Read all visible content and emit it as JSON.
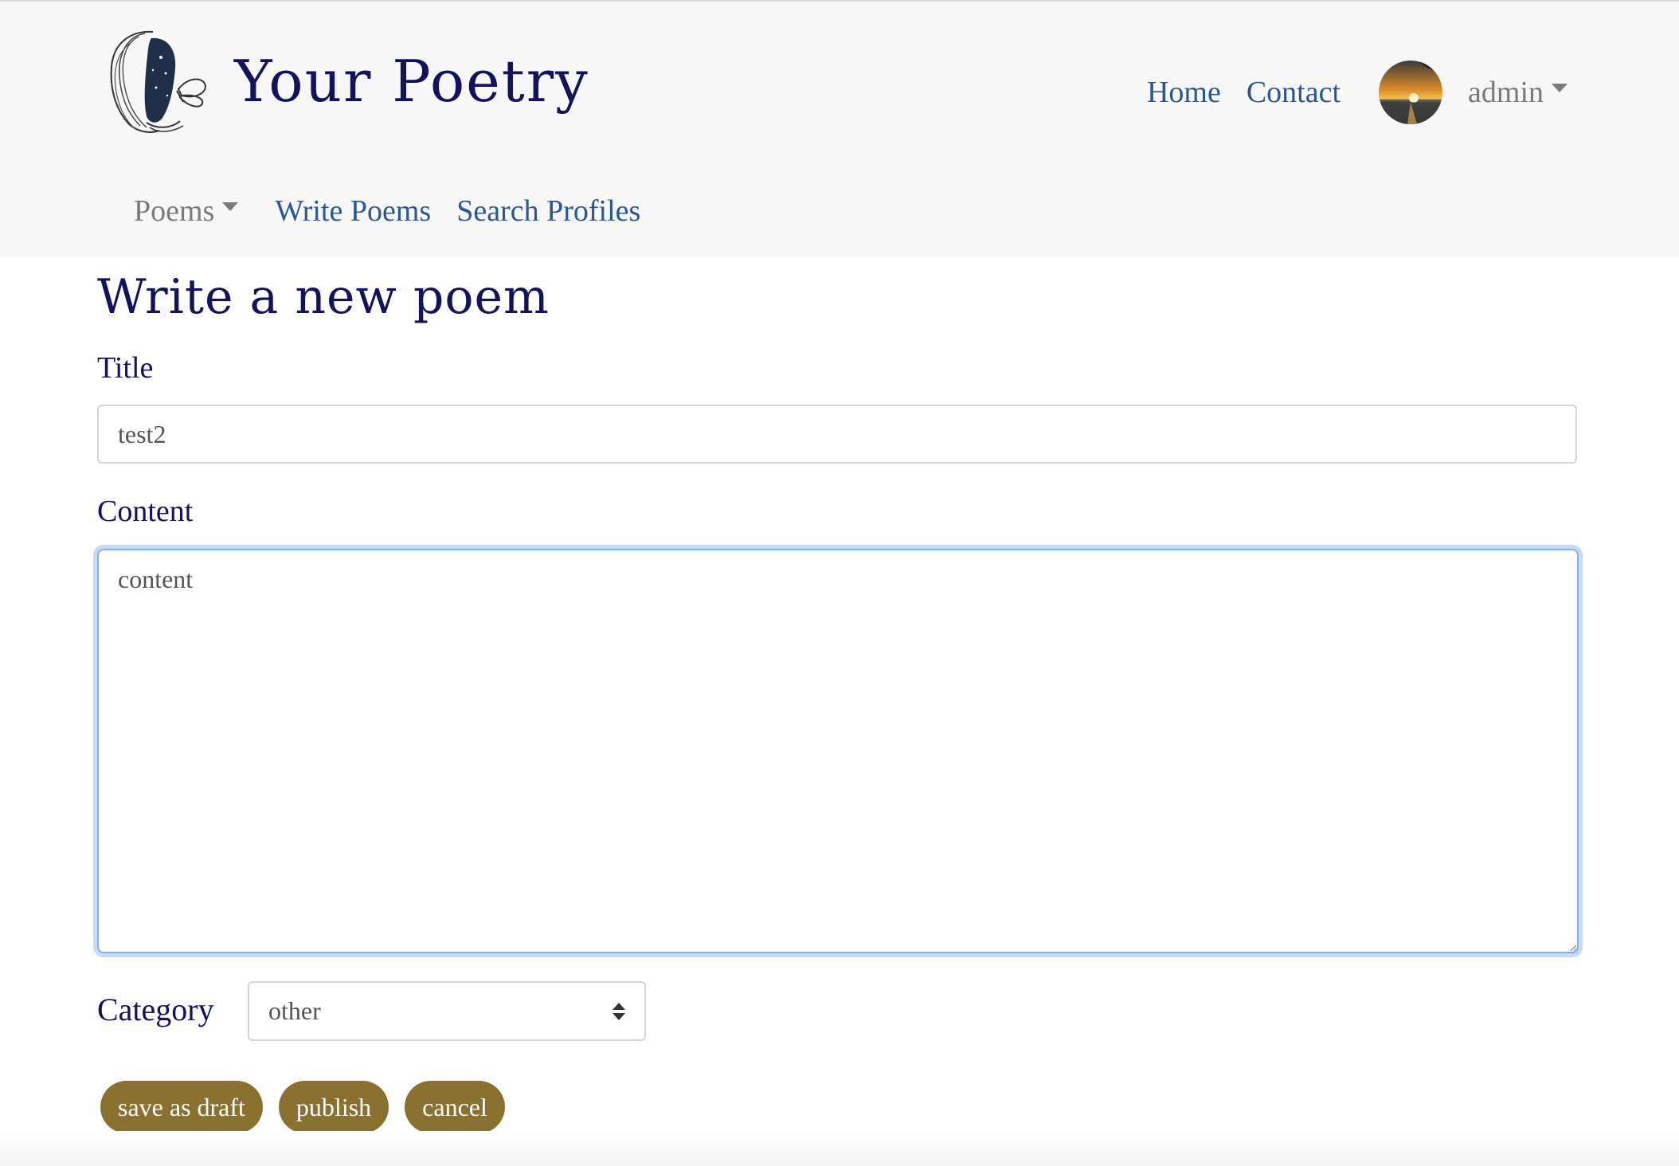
{
  "app": {
    "brand_name": "Your Poetry"
  },
  "top_nav": {
    "home": "Home",
    "contact": "Contact",
    "user": "admin"
  },
  "sub_nav": {
    "poems": "Poems",
    "write_poems": "Write Poems",
    "search_profiles": "Search Profiles"
  },
  "form": {
    "heading": "Write a new poem",
    "title_label": "Title",
    "title_value": "test2",
    "content_label": "Content",
    "content_value": "content",
    "category_label": "Category",
    "category_value": "other"
  },
  "actions": {
    "save_draft": "save as draft",
    "publish": "publish",
    "cancel": "cancel"
  },
  "colors": {
    "heading": "#12135c",
    "link": "#2a5794",
    "muted": "#7b7b7b",
    "button": "#8b7130",
    "focus_border": "#7fb0ef"
  },
  "icons": {
    "logo": "woman-butterfly-logo",
    "avatar": "sunset-avatar",
    "caret": "chevron-down-icon",
    "select_arrows": "updown-icon"
  }
}
